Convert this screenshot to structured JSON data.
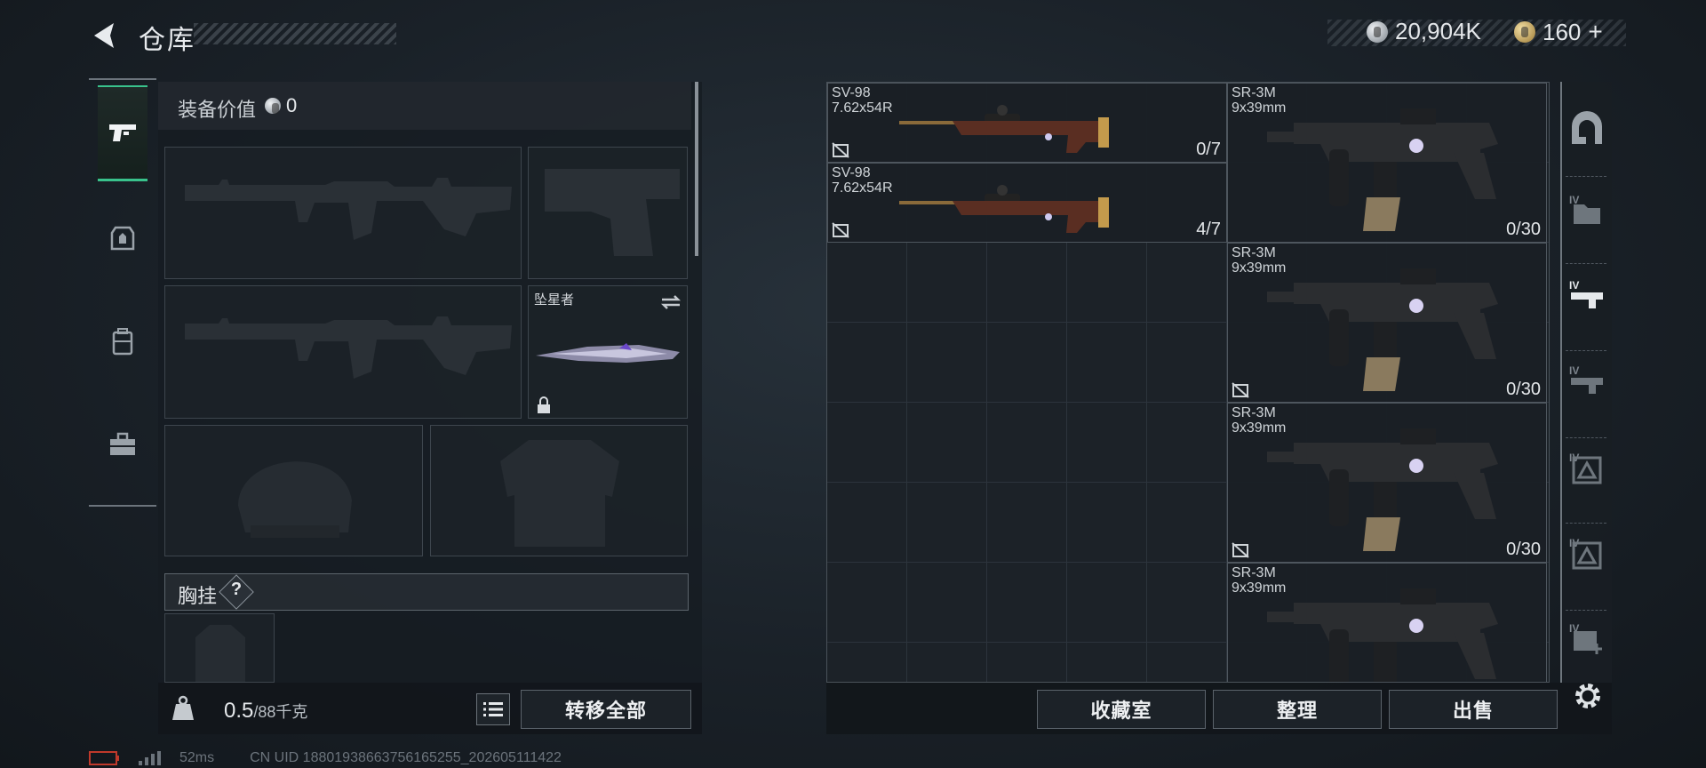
{
  "header": {
    "title": "仓库",
    "back_icon": "back-arrow-icon",
    "silver_amount": "20,904K",
    "gold_amount": "160",
    "gold_add": "+"
  },
  "categories": [
    {
      "name": "weapons",
      "icon": "pistol-icon",
      "active": true
    },
    {
      "name": "consumables",
      "icon": "medkit-icon",
      "active": false
    },
    {
      "name": "backpack",
      "icon": "backpack-icon",
      "active": false
    },
    {
      "name": "toolbox",
      "icon": "toolbox-icon",
      "active": false
    }
  ],
  "equipment": {
    "value_label": "装备价值",
    "value": "0",
    "melee_name": "坠星者",
    "chest_rig_label": "胸挂",
    "chest_rig_help": "?"
  },
  "weight": {
    "current": "0.5",
    "max": "/88千克"
  },
  "buttons": {
    "transfer_all": "转移全部",
    "collection_room": "收藏室",
    "sort": "整理",
    "sell": "出售"
  },
  "storage_items": [
    {
      "name": "SV-98",
      "ammo": "7.62x54R",
      "count": "0/7",
      "color": "#6b3f2c"
    },
    {
      "name": "SV-98",
      "ammo": "7.62x54R",
      "count": "4/7",
      "color": "#6b3f2c"
    },
    {
      "name": "SR-3M",
      "ammo": "9x39mm",
      "count": "0/30",
      "color": "#2b2d30"
    },
    {
      "name": "SR-3M",
      "ammo": "9x39mm",
      "count": "0/30",
      "color": "#2b2d30"
    },
    {
      "name": "SR-3M",
      "ammo": "9x39mm",
      "count": "0/30",
      "color": "#2b2d30"
    },
    {
      "name": "SR-3M",
      "ammo": "9x39mm",
      "count": "",
      "color": "#2b2d30"
    }
  ],
  "containers": [
    {
      "icon": "safe-box-icon",
      "tier": ""
    },
    {
      "icon": "case-icon",
      "tier": "IV"
    },
    {
      "icon": "weapon-case-icon",
      "tier": "IV"
    },
    {
      "icon": "weapon-case-icon",
      "tier": "IV"
    },
    {
      "icon": "ammo-case-icon",
      "tier": "IV"
    },
    {
      "icon": "ammo-case-icon",
      "tier": "IV"
    },
    {
      "icon": "medical-case-icon",
      "tier": "IV"
    }
  ],
  "status": {
    "ping": "52ms",
    "uid": "CN UID 18801938663756165255_202605111422"
  }
}
